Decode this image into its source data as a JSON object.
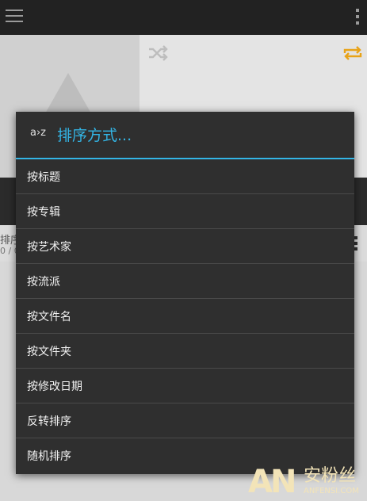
{
  "dialog": {
    "icon_text": "a›z",
    "title": "排序方式...",
    "options": [
      {
        "label": "按标题"
      },
      {
        "label": "按专辑"
      },
      {
        "label": "按艺术家"
      },
      {
        "label": "按流派"
      },
      {
        "label": "按文件名"
      },
      {
        "label": "按文件夹"
      },
      {
        "label": "按修改日期"
      },
      {
        "label": "反转排序"
      },
      {
        "label": "随机排序"
      }
    ]
  },
  "background": {
    "queue_title": "排序",
    "queue_sub": "0 / 0"
  },
  "watermark": {
    "logo": "AN",
    "name": "安粉丝",
    "url": "ANFENSI.COM"
  },
  "colors": {
    "accent": "#33b5e5",
    "topbar": "#222222",
    "dialog_bg": "#2f2f2f",
    "repeat_icon": "#e8a318"
  }
}
